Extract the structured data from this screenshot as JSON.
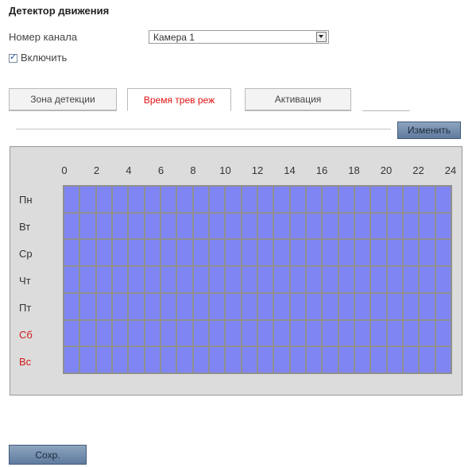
{
  "title": "Детектор движения",
  "channel": {
    "label": "Номер канала",
    "value": "Камера 1"
  },
  "enable": {
    "label": "Включить",
    "checked": true
  },
  "tabs": [
    {
      "label": "Зона детекции",
      "active": false
    },
    {
      "label": "Время трев реж",
      "active": true
    },
    {
      "label": "Активация",
      "active": false
    }
  ],
  "edit_button": "Изменить",
  "schedule": {
    "hours": [
      "0",
      "2",
      "4",
      "6",
      "8",
      "10",
      "12",
      "14",
      "16",
      "18",
      "20",
      "22",
      "24"
    ],
    "days": [
      {
        "label": "Пн",
        "weekend": false
      },
      {
        "label": "Вт",
        "weekend": false
      },
      {
        "label": "Ср",
        "weekend": false
      },
      {
        "label": "Чт",
        "weekend": false
      },
      {
        "label": "Пт",
        "weekend": false
      },
      {
        "label": "Сб",
        "weekend": true
      },
      {
        "label": "Вс",
        "weekend": true
      }
    ],
    "active_color": "#7f86f4"
  },
  "save_button": "Сохр."
}
